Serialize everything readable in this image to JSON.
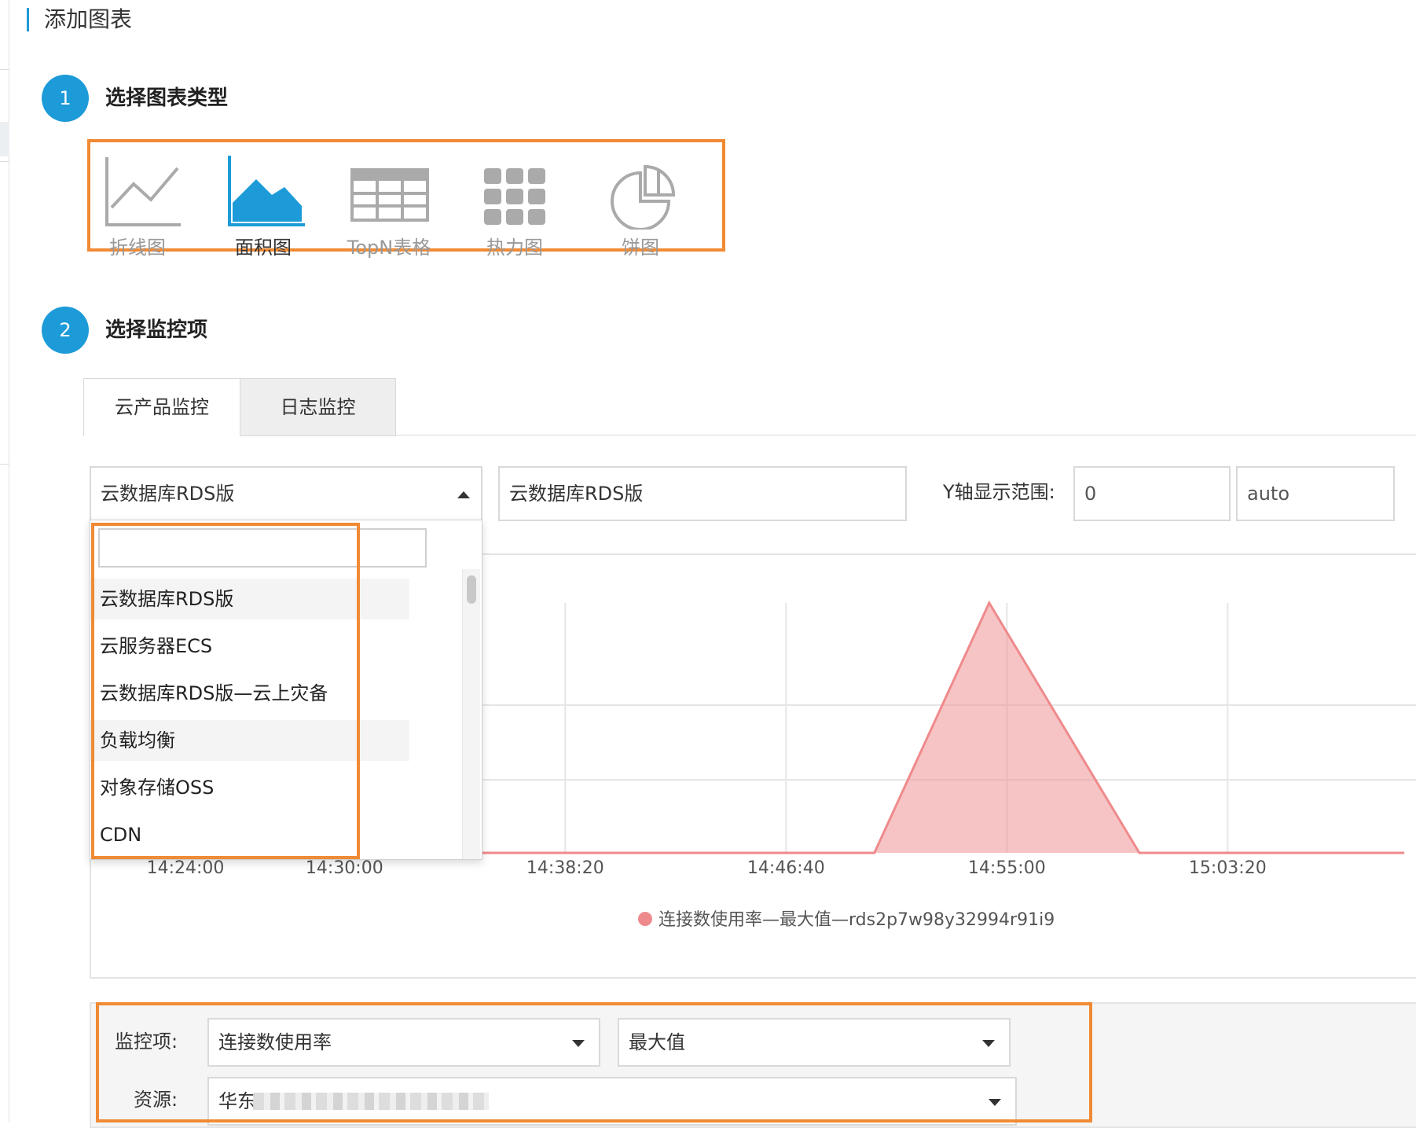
{
  "page": {
    "title": "添加图表"
  },
  "step1": {
    "number": "1",
    "label": "选择图表类型",
    "chart_types": [
      {
        "label": "折线图",
        "icon": "line-chart-icon",
        "active": false
      },
      {
        "label": "面积图",
        "icon": "area-chart-icon",
        "active": true
      },
      {
        "label": "TopN表格",
        "icon": "table-icon",
        "active": false
      },
      {
        "label": "热力图",
        "icon": "heatmap-icon",
        "active": false
      },
      {
        "label": "饼图",
        "icon": "pie-chart-icon",
        "active": false
      }
    ]
  },
  "step2": {
    "number": "2",
    "label": "选择监控项",
    "tabs": [
      {
        "label": "云产品监控",
        "active": true
      },
      {
        "label": "日志监控",
        "active": false
      }
    ]
  },
  "filters": {
    "product_select": "云数据库RDS版",
    "chart_name": "云数据库RDS版",
    "y_range_label": "Y轴显示范围:",
    "y_min": "0",
    "y_max": "auto"
  },
  "dropdown": {
    "search_value": "",
    "items": [
      {
        "label": "云数据库RDS版",
        "highlighted": true
      },
      {
        "label": "云服务器ECS",
        "highlighted": false
      },
      {
        "label": "云数据库RDS版—云上灾备",
        "highlighted": false
      },
      {
        "label": "负载均衡",
        "highlighted": true
      },
      {
        "label": "对象存储OSS",
        "highlighted": false
      },
      {
        "label": "CDN",
        "highlighted": false
      }
    ]
  },
  "chart_data": {
    "type": "area",
    "x": [
      "14:24:00",
      "14:30:00",
      "14:38:20",
      "14:46:40",
      "14:55:00",
      "15:03:20"
    ],
    "series": [
      {
        "name": "连接数使用率—最大值—rds2p7w98y32994r91i9",
        "color": "#ef8a8c",
        "points": [
          {
            "x": "14:24:00",
            "y": 0
          },
          {
            "x": "14:50:00",
            "y": 0
          },
          {
            "x": "14:54:20",
            "y": 1
          },
          {
            "x": "15:00:00",
            "y": 0
          },
          {
            "x": "15:10:00",
            "y": 0
          }
        ]
      }
    ],
    "grid": true,
    "legend_position": "bottom"
  },
  "config": {
    "metric_label": "监控项:",
    "metric_value": "连接数使用率",
    "stat_value": "最大值",
    "resource_label": "资源:",
    "resource_value": "华东"
  },
  "colors": {
    "accent": "#1d9bd8",
    "highlight_box": "#f08a34",
    "series": "#ef8a8c"
  }
}
